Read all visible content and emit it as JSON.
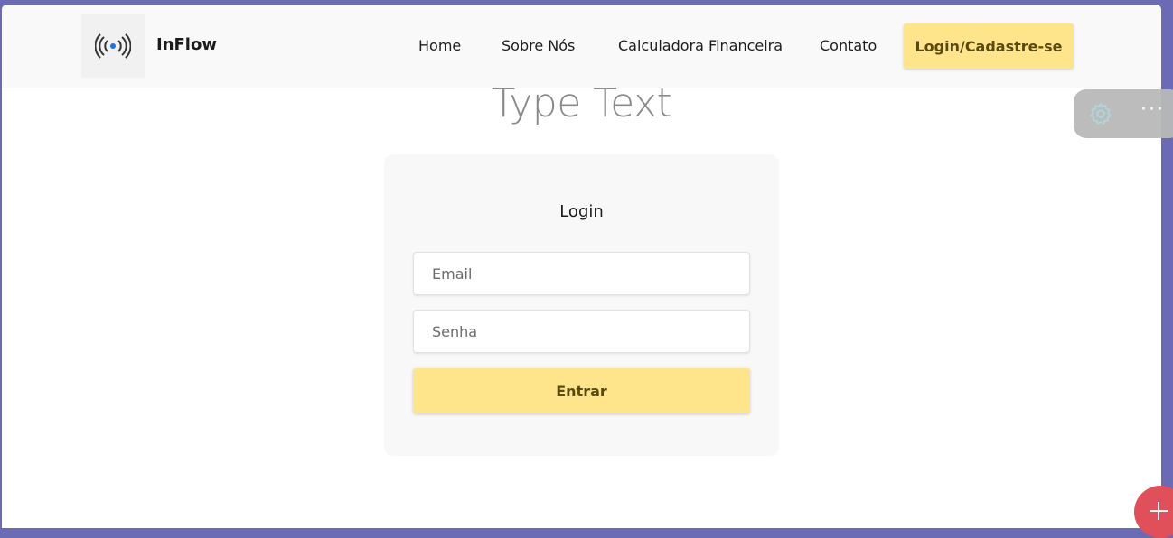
{
  "brand": {
    "name": "InFlow",
    "logo_icon": "broadcast-icon"
  },
  "nav": {
    "links": [
      "Home",
      "Sobre Nós",
      "Calculadora Financeira",
      "Contato"
    ],
    "cta": "Login/Cadastre-se"
  },
  "hero": {
    "text": "Type Text"
  },
  "login": {
    "title": "Login",
    "email_placeholder": "Email",
    "password_placeholder": "Senha",
    "submit_label": "Entrar"
  },
  "tools": {
    "settings_icon": "gear-icon",
    "more": "···"
  },
  "fab": {
    "icon": "plus-icon"
  },
  "colors": {
    "accent": "#fee48a",
    "accent_text": "#5a4a10",
    "fab": "#e0505b",
    "logo_dot": "#1f6fe0"
  }
}
